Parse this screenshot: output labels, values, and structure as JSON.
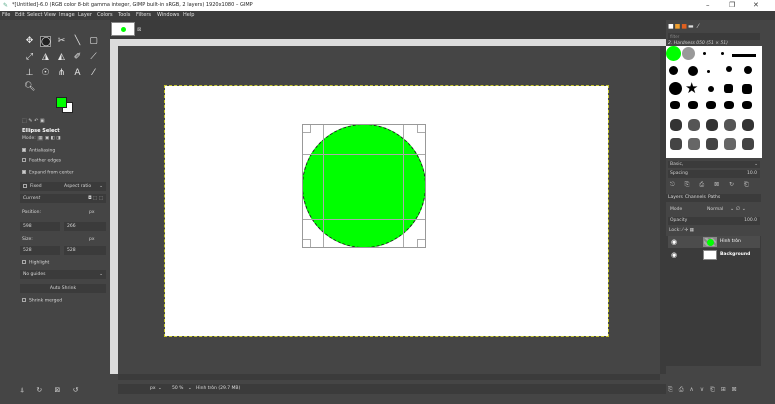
{
  "window": {
    "title": "*[Untitled]-6.0 (RGB color 8-bit gamma integer, GIMP built-in sRGB, 2 layers) 1920x1080 – GIMP",
    "min": "–",
    "max": "❐",
    "close": "✕"
  },
  "menu": [
    "File",
    "Edit",
    "Select",
    "View",
    "Image",
    "Layer",
    "Colors",
    "Tools",
    "Filters",
    "Windows",
    "Help"
  ],
  "tool_options": {
    "title": "Ellipse Select",
    "mode_label": "Mode:",
    "antialiasing": "Antialiasing",
    "feather": "Feather edges",
    "expand": "Expand from center",
    "fixed": "Fixed",
    "aspect": "Aspect ratio",
    "current": "Current",
    "position_label": "Position:",
    "position_unit": "px",
    "pos_x": "598",
    "pos_y": "266",
    "size_label": "Size:",
    "size_unit": "px",
    "size_w": "528",
    "size_h": "528",
    "highlight": "Highlight",
    "guides": "No guides",
    "autoshrink": "Auto Shrink",
    "shrink_merged": "Shrink merged"
  },
  "status": {
    "unit": "px",
    "zoom": "50 %",
    "info": "Hình tròn (29.7 MB)"
  },
  "brushes": {
    "filter": "filter",
    "name": "2. Hardness 050 (51 × 51)",
    "preset": "Basic,",
    "spacing_label": "Spacing",
    "spacing_value": "10.0"
  },
  "layers": {
    "tabs": [
      "Layers",
      "Channels",
      "Paths"
    ],
    "mode_label": "Mode",
    "mode_value": "Normal",
    "opacity_label": "Opacity",
    "opacity_value": "100.0",
    "lock_label": "Lock:",
    "items": [
      {
        "name": "Hình tròn"
      },
      {
        "name": "Background"
      }
    ]
  },
  "colors": {
    "accent": "#00ff00",
    "bg": "#454545"
  }
}
